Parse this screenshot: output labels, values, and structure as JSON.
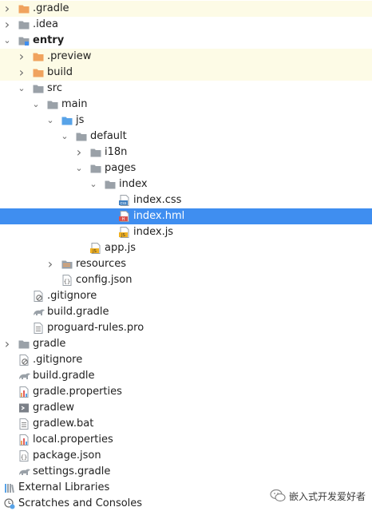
{
  "colors": {
    "selection": "#3f8ef0",
    "highlight": "#fdfbe6",
    "folder_orange": "#f0a35e",
    "folder_grey": "#9aa1a8",
    "folder_blue": "#58a3e8"
  },
  "tree": [
    {
      "label": ".gradle",
      "depth": 0,
      "arrow": "collapsed",
      "icon": "orange-folder-icon",
      "highlight": true
    },
    {
      "label": ".idea",
      "depth": 0,
      "arrow": "collapsed",
      "icon": "folder-icon"
    },
    {
      "label": "entry",
      "depth": 0,
      "arrow": "expanded",
      "icon": "module-folder-icon",
      "bold": true
    },
    {
      "label": ".preview",
      "depth": 1,
      "arrow": "collapsed",
      "icon": "orange-folder-icon",
      "highlight": true
    },
    {
      "label": "build",
      "depth": 1,
      "arrow": "collapsed",
      "icon": "orange-folder-icon",
      "highlight": true
    },
    {
      "label": "src",
      "depth": 1,
      "arrow": "expanded",
      "icon": "folder-icon"
    },
    {
      "label": "main",
      "depth": 2,
      "arrow": "expanded",
      "icon": "folder-icon"
    },
    {
      "label": "js",
      "depth": 3,
      "arrow": "expanded",
      "icon": "blue-folder-icon"
    },
    {
      "label": "default",
      "depth": 4,
      "arrow": "expanded",
      "icon": "folder-icon"
    },
    {
      "label": "i18n",
      "depth": 5,
      "arrow": "collapsed",
      "icon": "folder-icon"
    },
    {
      "label": "pages",
      "depth": 5,
      "arrow": "expanded",
      "icon": "folder-icon"
    },
    {
      "label": "index",
      "depth": 6,
      "arrow": "expanded",
      "icon": "folder-icon"
    },
    {
      "label": "index.css",
      "depth": 7,
      "icon": "css-file-icon"
    },
    {
      "label": "index.hml",
      "depth": 7,
      "icon": "hml-file-icon",
      "selected": true
    },
    {
      "label": "index.js",
      "depth": 7,
      "icon": "js-file-icon"
    },
    {
      "label": "app.js",
      "depth": 5,
      "icon": "js-file-icon"
    },
    {
      "label": "resources",
      "depth": 3,
      "arrow": "collapsed",
      "icon": "resources-folder-icon"
    },
    {
      "label": "config.json",
      "depth": 3,
      "icon": "json-file-icon"
    },
    {
      "label": ".gitignore",
      "depth": 1,
      "icon": "gitignore-file-icon"
    },
    {
      "label": "build.gradle",
      "depth": 1,
      "icon": "gradle-file-icon"
    },
    {
      "label": "proguard-rules.pro",
      "depth": 1,
      "icon": "text-file-icon"
    },
    {
      "label": "gradle",
      "depth": 0,
      "arrow": "collapsed",
      "icon": "folder-icon"
    },
    {
      "label": ".gitignore",
      "depth": 0,
      "icon": "gitignore-file-icon"
    },
    {
      "label": "build.gradle",
      "depth": 0,
      "icon": "gradle-file-icon"
    },
    {
      "label": "gradle.properties",
      "depth": 0,
      "icon": "properties-file-icon"
    },
    {
      "label": "gradlew",
      "depth": 0,
      "icon": "shell-file-icon"
    },
    {
      "label": "gradlew.bat",
      "depth": 0,
      "icon": "text-file-icon"
    },
    {
      "label": "local.properties",
      "depth": 0,
      "icon": "properties-file-icon"
    },
    {
      "label": "package.json",
      "depth": 0,
      "icon": "json-file-icon"
    },
    {
      "label": "settings.gradle",
      "depth": 0,
      "icon": "gradle-file-icon"
    },
    {
      "label": "External Libraries",
      "depth": -1,
      "arrow": "collapsed",
      "icon": "library-icon"
    },
    {
      "label": "Scratches and Consoles",
      "depth": -1,
      "arrow": "collapsed",
      "icon": "scratches-icon"
    }
  ],
  "watermark": {
    "text": "嵌入式开发爱好者",
    "icon": "wechat-logo-icon"
  }
}
